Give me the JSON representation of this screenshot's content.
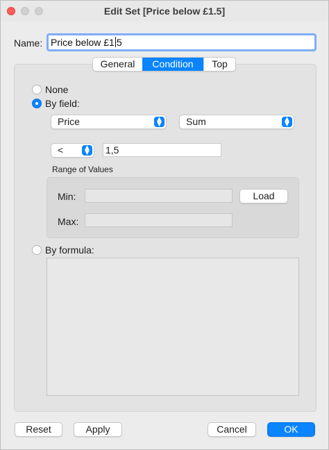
{
  "window": {
    "title": "Edit Set [Price below £1.5]"
  },
  "name": {
    "label": "Name:",
    "value_before_cursor": "Price below £1",
    "value_after_cursor": "5"
  },
  "tabs": [
    {
      "label": "General",
      "active": false
    },
    {
      "label": "Condition",
      "active": true
    },
    {
      "label": "Top",
      "active": false
    }
  ],
  "condition": {
    "none_label": "None",
    "by_field_label": "By field:",
    "field_select": "Price",
    "aggregation_select": "Sum",
    "operator_select": "<",
    "value": "1,5",
    "range_label": "Range of Values",
    "min_label": "Min:",
    "max_label": "Max:",
    "min_value": "",
    "max_value": "",
    "load_button": "Load",
    "by_formula_label": "By formula:",
    "formula_text": "",
    "selected_option": "by_field"
  },
  "footer": {
    "reset_button": "Reset",
    "apply_button": "Apply",
    "cancel_button": "Cancel",
    "ok_button": "OK"
  },
  "colors": {
    "accent": "#0a84ff",
    "close": "#fe5f57",
    "focus_ring": "#7eaef5"
  }
}
